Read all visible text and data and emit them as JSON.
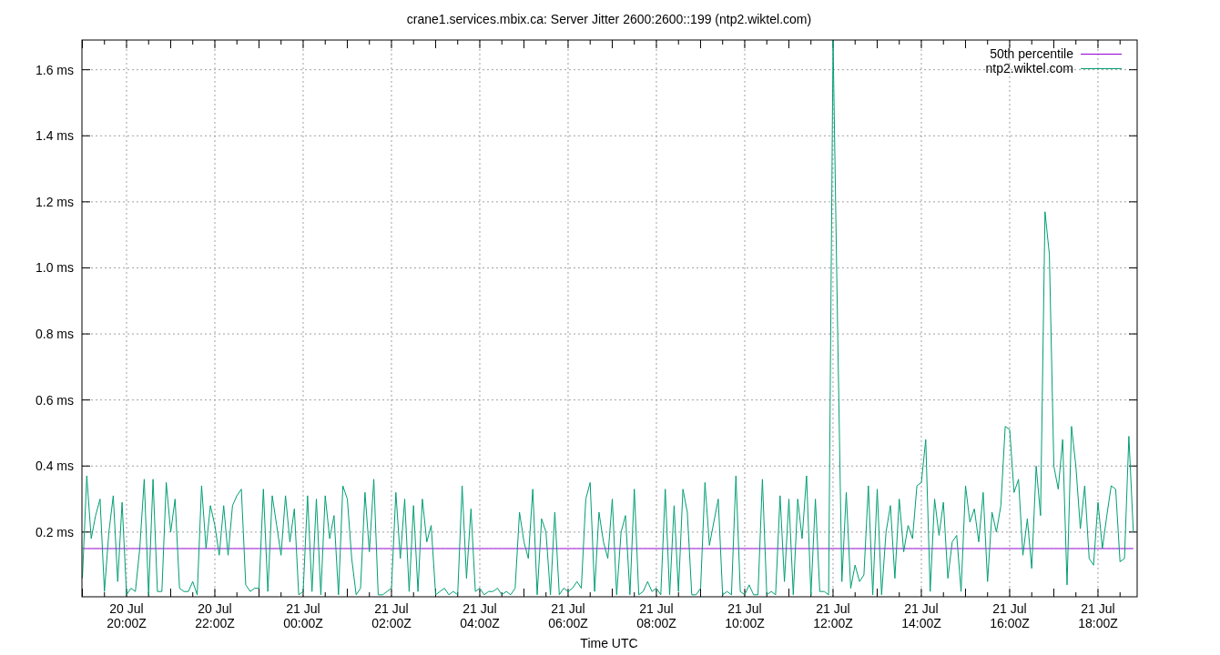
{
  "chart": {
    "chart_data": {
      "type": "line",
      "title": "crane1.services.mbix.ca: Server Jitter 2600:2600::199 (ntp2.wiktel.com)",
      "xlabel": "Time UTC",
      "grid": true,
      "legend": true,
      "ylim": [
        0.004,
        1.69
      ],
      "yticks": [
        {
          "value": 0.2,
          "label": "0.2 ms"
        },
        {
          "value": 0.4,
          "label": "0.4 ms"
        },
        {
          "value": 0.6,
          "label": "0.6 ms"
        },
        {
          "value": 0.8,
          "label": "0.8 ms"
        },
        {
          "value": 1.0,
          "label": "1.0 ms"
        },
        {
          "value": 1.2,
          "label": "1.2 ms"
        },
        {
          "value": 1.4,
          "label": "1.4 ms"
        },
        {
          "value": 1.6,
          "label": "1.6 ms"
        }
      ],
      "categories": [
        null,
        null,
        null,
        null,
        null,
        null,
        null,
        null,
        null,
        null,
        "20 Jul\n20:00Z",
        null,
        null,
        null,
        null,
        null,
        null,
        null,
        null,
        null,
        null,
        null,
        null,
        null,
        null,
        null,
        null,
        null,
        null,
        null,
        "20 Jul\n22:00Z",
        null,
        null,
        null,
        null,
        null,
        null,
        null,
        null,
        null,
        null,
        null,
        null,
        null,
        null,
        null,
        null,
        null,
        null,
        null,
        "21 Jul\n00:00Z",
        null,
        null,
        null,
        null,
        null,
        null,
        null,
        null,
        null,
        null,
        null,
        null,
        null,
        null,
        null,
        null,
        null,
        null,
        null,
        "21 Jul\n02:00Z",
        null,
        null,
        null,
        null,
        null,
        null,
        null,
        null,
        null,
        null,
        null,
        null,
        null,
        null,
        null,
        null,
        null,
        null,
        null,
        "21 Jul\n04:00Z",
        null,
        null,
        null,
        null,
        null,
        null,
        null,
        null,
        null,
        null,
        null,
        null,
        null,
        null,
        null,
        null,
        null,
        null,
        null,
        "21 Jul\n06:00Z",
        null,
        null,
        null,
        null,
        null,
        null,
        null,
        null,
        null,
        null,
        null,
        null,
        null,
        null,
        null,
        null,
        null,
        null,
        null,
        "21 Jul\n08:00Z",
        null,
        null,
        null,
        null,
        null,
        null,
        null,
        null,
        null,
        null,
        null,
        null,
        null,
        null,
        null,
        null,
        null,
        null,
        null,
        "21 Jul\n10:00Z",
        null,
        null,
        null,
        null,
        null,
        null,
        null,
        null,
        null,
        null,
        null,
        null,
        null,
        null,
        null,
        null,
        null,
        null,
        null,
        "21 Jul\n12:00Z",
        null,
        null,
        null,
        null,
        null,
        null,
        null,
        null,
        null,
        null,
        null,
        null,
        null,
        null,
        null,
        null,
        null,
        null,
        null,
        "21 Jul\n14:00Z",
        null,
        null,
        null,
        null,
        null,
        null,
        null,
        null,
        null,
        null,
        null,
        null,
        null,
        null,
        null,
        null,
        null,
        null,
        null,
        "21 Jul\n16:00Z",
        null,
        null,
        null,
        null,
        null,
        null,
        null,
        null,
        null,
        null,
        null,
        null,
        null,
        null,
        null,
        null,
        null,
        null,
        null,
        "21 Jul\n18:00Z",
        null,
        null,
        null,
        null,
        null,
        null,
        null,
        null
      ],
      "series": [
        {
          "name": "50th percentile",
          "color": "#9400d3",
          "values": [
            0.15,
            0.15,
            0.15,
            0.15,
            0.15,
            0.15,
            0.15,
            0.15,
            0.15,
            0.15,
            0.15,
            0.15,
            0.15,
            0.15,
            0.15,
            0.15,
            0.15,
            0.15,
            0.15,
            0.15,
            0.15,
            0.15,
            0.15,
            0.15,
            0.15,
            0.15,
            0.15,
            0.15,
            0.15,
            0.15,
            0.15,
            0.15,
            0.15,
            0.15,
            0.15,
            0.15,
            0.15,
            0.15,
            0.15,
            0.15,
            0.15,
            0.15,
            0.15,
            0.15,
            0.15,
            0.15,
            0.15,
            0.15,
            0.15,
            0.15,
            0.15,
            0.15,
            0.15,
            0.15,
            0.15,
            0.15,
            0.15,
            0.15,
            0.15,
            0.15,
            0.15,
            0.15,
            0.15,
            0.15,
            0.15,
            0.15,
            0.15,
            0.15,
            0.15,
            0.15,
            0.15,
            0.15,
            0.15,
            0.15,
            0.15,
            0.15,
            0.15,
            0.15,
            0.15,
            0.15,
            0.15,
            0.15,
            0.15,
            0.15,
            0.15,
            0.15,
            0.15,
            0.15,
            0.15,
            0.15,
            0.15,
            0.15,
            0.15,
            0.15,
            0.15,
            0.15,
            0.15,
            0.15,
            0.15,
            0.15,
            0.15,
            0.15,
            0.15,
            0.15,
            0.15,
            0.15,
            0.15,
            0.15,
            0.15,
            0.15,
            0.15,
            0.15,
            0.15,
            0.15,
            0.15,
            0.15,
            0.15,
            0.15,
            0.15,
            0.15,
            0.15,
            0.15,
            0.15,
            0.15,
            0.15,
            0.15,
            0.15,
            0.15,
            0.15,
            0.15,
            0.15,
            0.15,
            0.15,
            0.15,
            0.15,
            0.15,
            0.15,
            0.15,
            0.15,
            0.15,
            0.15,
            0.15,
            0.15,
            0.15,
            0.15,
            0.15,
            0.15,
            0.15,
            0.15,
            0.15,
            0.15,
            0.15,
            0.15,
            0.15,
            0.15,
            0.15,
            0.15,
            0.15,
            0.15,
            0.15,
            0.15,
            0.15,
            0.15,
            0.15,
            0.15,
            0.15,
            0.15,
            0.15,
            0.15,
            0.15,
            0.15,
            0.15,
            0.15,
            0.15,
            0.15,
            0.15,
            0.15,
            0.15,
            0.15,
            0.15,
            0.15,
            0.15,
            0.15,
            0.15,
            0.15,
            0.15,
            0.15,
            0.15,
            0.15,
            0.15,
            0.15,
            0.15,
            0.15,
            0.15,
            0.15,
            0.15,
            0.15,
            0.15,
            0.15,
            0.15,
            0.15,
            0.15,
            0.15,
            0.15,
            0.15,
            0.15,
            0.15,
            0.15,
            0.15,
            0.15,
            0.15,
            0.15,
            0.15,
            0.15,
            0.15,
            0.15,
            0.15,
            0.15,
            0.15,
            0.15,
            0.15,
            0.15,
            0.15,
            0.15,
            0.15,
            0.15,
            0.15,
            0.15,
            0.15,
            0.15,
            0.15,
            0.15,
            0.15,
            0.15,
            0.15,
            0.15,
            0.15,
            0.15,
            0.15
          ]
        },
        {
          "name": "ntp2.wiktel.com",
          "color": "#009e73",
          "values": [
            0.06,
            0.37,
            0.18,
            0.25,
            0.3,
            0.02,
            0.2,
            0.31,
            0.05,
            0.29,
            0.01,
            0.03,
            0.02,
            0.15,
            0.36,
            0.01,
            0.36,
            0.02,
            0.02,
            0.35,
            0.2,
            0.3,
            0.03,
            0.02,
            0.02,
            0.05,
            0.01,
            0.34,
            0.15,
            0.28,
            0.22,
            0.13,
            0.28,
            0.13,
            0.28,
            0.31,
            0.33,
            0.04,
            0.02,
            0.03,
            0.03,
            0.33,
            0.02,
            0.31,
            0.22,
            0.13,
            0.31,
            0.17,
            0.27,
            0.01,
            0.02,
            0.31,
            0.02,
            0.3,
            0.01,
            0.31,
            0.18,
            0.25,
            0.01,
            0.34,
            0.3,
            0.12,
            0.01,
            0.03,
            0.32,
            0.14,
            0.36,
            0.01,
            0.01,
            0.02,
            0.03,
            0.32,
            0.12,
            0.3,
            0.02,
            0.28,
            0.02,
            0.3,
            0.17,
            0.22,
            0.01,
            0.02,
            0.03,
            0.01,
            0.02,
            0.01,
            0.34,
            0.06,
            0.27,
            0.02,
            0.03,
            0.01,
            0.02,
            0.02,
            0.03,
            0.01,
            0.02,
            0.01,
            0.03,
            0.26,
            0.17,
            0.12,
            0.33,
            0.01,
            0.24,
            0.2,
            0.01,
            0.26,
            0.01,
            0.03,
            0.02,
            0.03,
            0.05,
            0.03,
            0.3,
            0.35,
            0.02,
            0.26,
            0.17,
            0.12,
            0.3,
            0.01,
            0.2,
            0.25,
            0.01,
            0.33,
            0.01,
            0.02,
            0.05,
            0.02,
            0.03,
            0.01,
            0.33,
            0.01,
            0.28,
            0.02,
            0.33,
            0.26,
            0.01,
            0.01,
            0.03,
            0.35,
            0.16,
            0.23,
            0.3,
            0.01,
            0.02,
            0.01,
            0.37,
            0.02,
            0.01,
            0.04,
            0.01,
            0.01,
            0.36,
            0.01,
            0.02,
            0.01,
            0.31,
            0.05,
            0.3,
            0.01,
            0.3,
            0.18,
            0.37,
            0.01,
            0.3,
            0.02,
            0.02,
            0.01,
            1.69,
            0.85,
            0.05,
            0.32,
            0.03,
            0.1,
            0.05,
            0.07,
            0.34,
            0.01,
            0.33,
            0.01,
            0.2,
            0.28,
            0.06,
            0.3,
            0.14,
            0.22,
            0.18,
            0.34,
            0.35,
            0.48,
            0.02,
            0.3,
            0.19,
            0.29,
            0.06,
            0.17,
            0.19,
            0.02,
            0.34,
            0.23,
            0.27,
            0.17,
            0.32,
            0.05,
            0.26,
            0.2,
            0.28,
            0.52,
            0.51,
            0.32,
            0.36,
            0.13,
            0.24,
            0.09,
            0.4,
            0.25,
            1.17,
            1.04,
            0.4,
            0.33,
            0.48,
            0.04,
            0.52,
            0.4,
            0.21,
            0.34,
            0.12,
            0.1,
            0.29,
            0.15,
            0.25,
            0.34,
            0.33,
            0.11,
            0.12,
            0.49,
            0.2
          ]
        }
      ]
    }
  }
}
